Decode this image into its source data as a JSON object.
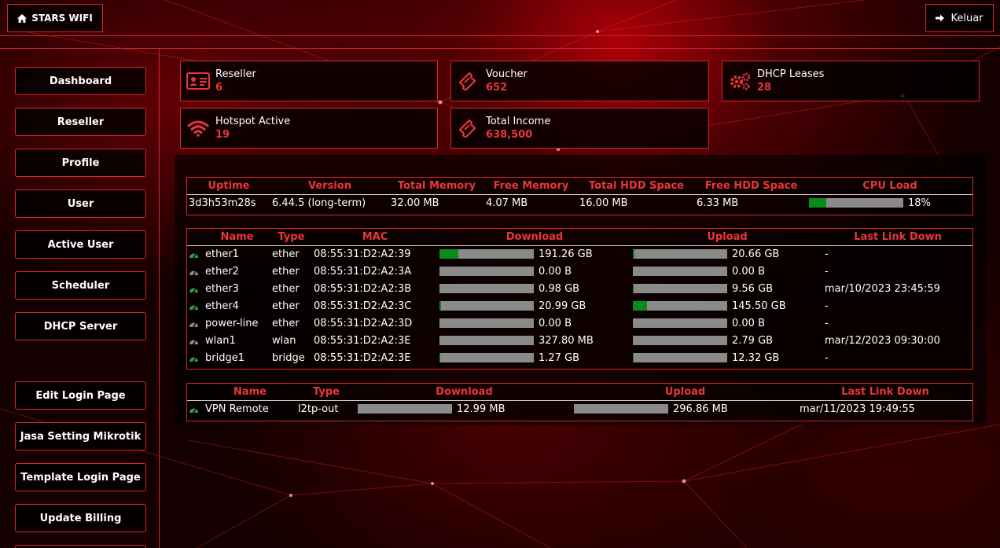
{
  "header": {
    "brand": "STARS WIFI",
    "logout": "Keluar"
  },
  "sidebar": {
    "items": [
      {
        "label": "Dashboard"
      },
      {
        "label": "Reseller"
      },
      {
        "label": "Profile"
      },
      {
        "label": "User"
      },
      {
        "label": "Active User"
      },
      {
        "label": "Scheduler"
      },
      {
        "label": "DHCP Server"
      },
      {
        "label": "Edit Login Page"
      },
      {
        "label": "Jasa Setting Mikrotik"
      },
      {
        "label": "Template Login Page"
      },
      {
        "label": "Update Billing"
      }
    ]
  },
  "cards": {
    "reseller": {
      "label": "Reseller",
      "value": "6"
    },
    "voucher": {
      "label": "Voucher",
      "value": "652"
    },
    "dhcp": {
      "label": "DHCP Leases",
      "value": "28"
    },
    "hotspot": {
      "label": "Hotspot Active",
      "value": "19"
    },
    "income": {
      "label": "Total Income",
      "value": "638,500"
    }
  },
  "system": {
    "headers": [
      "Uptime",
      "Version",
      "Total Memory",
      "Free Memory",
      "Total HDD Space",
      "Free HDD Space",
      "CPU Load"
    ],
    "uptime": "3d3h53m28s",
    "version": "6.44.5 (long-term)",
    "total_memory": "32.00 MB",
    "free_memory": "4.07 MB",
    "total_hdd": "16.00 MB",
    "free_hdd": "6.33 MB",
    "cpu_load": "18%",
    "cpu_load_fraction": 0.18
  },
  "interfaces": {
    "headers": [
      "Name",
      "Type",
      "MAC",
      "Download",
      "Upload",
      "Last Link Down"
    ],
    "rows": [
      {
        "name": "ether1",
        "type": "ether",
        "mac": "08:55:31:D2:A2:39",
        "download": "191.26 GB",
        "download_fill": 0.2,
        "upload": "20.66 GB",
        "upload_fill": 0.02,
        "last_down": "-",
        "active": true
      },
      {
        "name": "ether2",
        "type": "ether",
        "mac": "08:55:31:D2:A2:3A",
        "download": "0.00 B",
        "download_fill": 0,
        "upload": "0.00 B",
        "upload_fill": 0,
        "last_down": "-",
        "active": false
      },
      {
        "name": "ether3",
        "type": "ether",
        "mac": "08:55:31:D2:A2:3B",
        "download": "0.98 GB",
        "download_fill": 0,
        "upload": "9.56 GB",
        "upload_fill": 0.01,
        "last_down": "mar/10/2023 23:45:59",
        "active": true
      },
      {
        "name": "ether4",
        "type": "ether",
        "mac": "08:55:31:D2:A2:3C",
        "download": "20.99 GB",
        "download_fill": 0.02,
        "upload": "145.50 GB",
        "upload_fill": 0.15,
        "last_down": "-",
        "active": true
      },
      {
        "name": "power-line",
        "type": "ether",
        "mac": "08:55:31:D2:A2:3D",
        "download": "0.00 B",
        "download_fill": 0,
        "upload": "0.00 B",
        "upload_fill": 0,
        "last_down": "-",
        "active": false
      },
      {
        "name": "wlan1",
        "type": "wlan",
        "mac": "08:55:31:D2:A2:3E",
        "download": "327.80 MB",
        "download_fill": 0,
        "upload": "2.79 GB",
        "upload_fill": 0,
        "last_down": "mar/12/2023 09:30:00",
        "active": false
      },
      {
        "name": "bridge1",
        "type": "bridge",
        "mac": "08:55:31:D2:A2:3E",
        "download": "1.27 GB",
        "download_fill": 0.01,
        "upload": "12.32 GB",
        "upload_fill": 0.01,
        "last_down": "-",
        "active": true
      }
    ]
  },
  "vpn": {
    "headers": [
      "Name",
      "Type",
      "Download",
      "Upload",
      "Last Link Down"
    ],
    "rows": [
      {
        "name": "VPN Remote",
        "type": "l2tp-out",
        "download": "12.99 MB",
        "download_fill": 0,
        "upload": "296.86 MB",
        "upload_fill": 0,
        "last_down": "mar/11/2023 19:49:55",
        "active": true
      }
    ]
  },
  "colors": {
    "accent": "#d9262c",
    "value": "#e8363c",
    "active_icon": "#2e9e4a",
    "inactive_icon": "#8a8a8a",
    "bar_fill": "#0b8a1c",
    "bar_bg": "#8a8a8a"
  }
}
